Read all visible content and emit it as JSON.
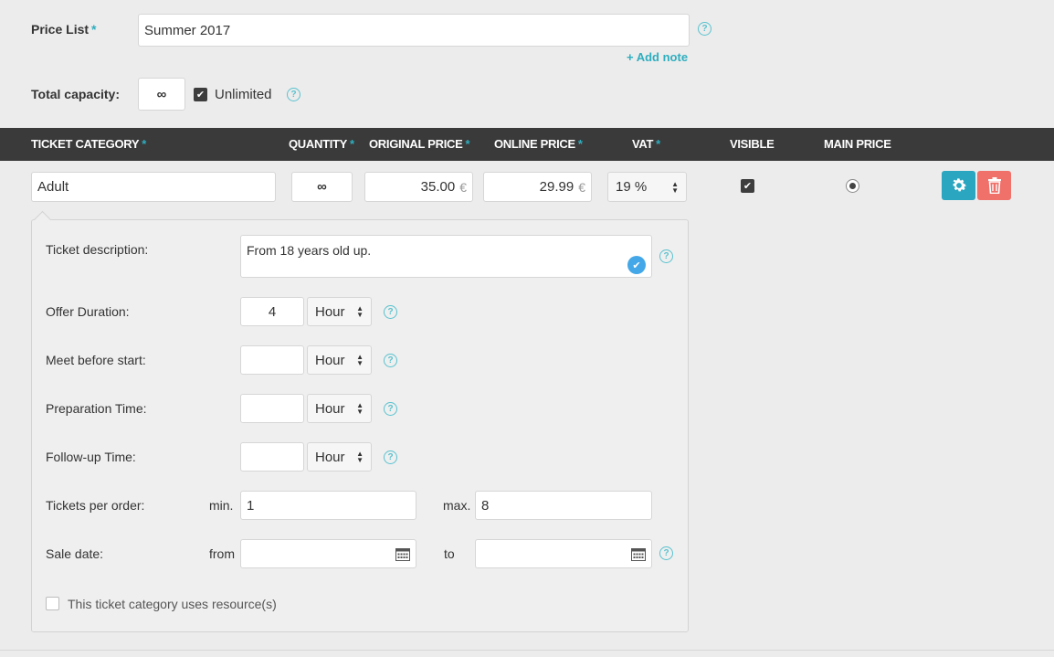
{
  "price_list": {
    "label": "Price List",
    "required": "*",
    "value": "Summer 2017",
    "add_note": "+ Add note"
  },
  "capacity": {
    "label": "Total capacity:",
    "value": "∞",
    "unlimited_label": "Unlimited",
    "unlimited_checked": true
  },
  "help_glyph": "?",
  "table": {
    "headers": {
      "category": "TICKET CATEGORY",
      "quantity": "QUANTITY",
      "original_price": "ORIGINAL PRICE",
      "online_price": "ONLINE PRICE",
      "vat": "VAT",
      "visible": "VISIBLE",
      "main_price": "MAIN PRICE"
    },
    "required_mark": "*",
    "row": {
      "category": "Adult",
      "quantity": "∞",
      "original_price": "35.00",
      "online_price": "29.99",
      "currency": "€",
      "vat": "19 %",
      "visible": true,
      "main_price": true
    }
  },
  "details": {
    "description_label": "Ticket description:",
    "description_value": "From 18 years old up.",
    "offer_duration_label": "Offer Duration:",
    "offer_duration_value": "4",
    "offer_duration_unit": "Hour",
    "meet_before_label": "Meet before start:",
    "meet_before_value": "",
    "meet_before_unit": "Hour",
    "prep_time_label": "Preparation Time:",
    "prep_time_value": "",
    "prep_time_unit": "Hour",
    "followup_label": "Follow-up Time:",
    "followup_value": "",
    "followup_unit": "Hour",
    "tickets_per_order_label": "Tickets per order:",
    "min_label": "min.",
    "min_value": "1",
    "max_label": "max.",
    "max_value": "8",
    "sale_date_label": "Sale date:",
    "from_label": "from",
    "from_value": "",
    "to_label": "to",
    "to_value": "",
    "resources_label": "This ticket category uses resource(s)",
    "resources_checked": false
  },
  "colors": {
    "accent": "#2eaebf",
    "header_bg": "#3a3a3a",
    "settings_button": "#2aa6c0",
    "delete_button": "#f0706a"
  }
}
